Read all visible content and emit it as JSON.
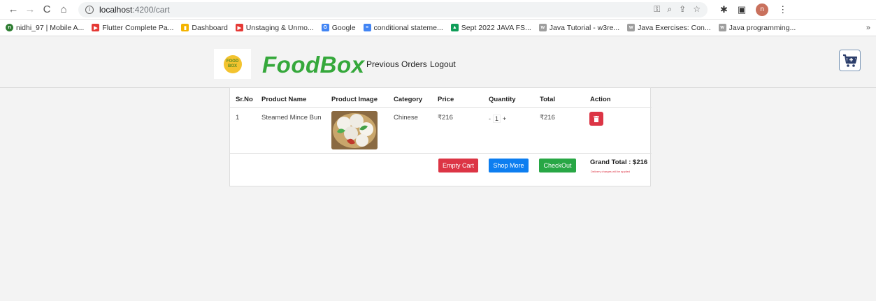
{
  "browser": {
    "url_host": "localhost",
    "url_path": ":4200/cart",
    "avatar_letter": "n",
    "bookmarks": [
      {
        "label": "nidhi_97 | Mobile A...",
        "color": "#2e7d32",
        "glyph": "n"
      },
      {
        "label": "Flutter Complete Pa...",
        "color": "#e53935",
        "glyph": "▶"
      },
      {
        "label": "Dashboard",
        "color": "#f4b400",
        "glyph": "▮"
      },
      {
        "label": "Unstaging & Unmo...",
        "color": "#e53935",
        "glyph": "▶"
      },
      {
        "label": "Google",
        "color": "#4285f4",
        "glyph": "G"
      },
      {
        "label": "conditional stateme...",
        "color": "#4285f4",
        "glyph": "≡"
      },
      {
        "label": "Sept 2022 JAVA FS...",
        "color": "#0f9d58",
        "glyph": "▲"
      },
      {
        "label": "Java Tutorial - w3re...",
        "color": "#9e9e9e",
        "glyph": "w"
      },
      {
        "label": "Java Exercises: Con...",
        "color": "#9e9e9e",
        "glyph": "w"
      },
      {
        "label": "Java programming...",
        "color": "#9e9e9e",
        "glyph": "w"
      }
    ],
    "more": "»"
  },
  "header": {
    "logo_line1": "FOOD",
    "logo_line2": "BOX",
    "brand": "FoodBox",
    "nav_previous_orders": "Previous Orders",
    "nav_logout": "Logout"
  },
  "cart": {
    "columns": {
      "srno": "Sr.No",
      "product_name": "Product Name",
      "product_image": "Product Image",
      "category": "Category",
      "price": "Price",
      "quantity": "Quantity",
      "total": "Total",
      "action": "Action"
    },
    "rows": [
      {
        "srno": "1",
        "product_name": "Steamed Mince Bun",
        "category": "Chinese",
        "price": "₹216",
        "qty_minus": "-",
        "quantity": "1",
        "qty_plus": "+",
        "total": "₹216"
      }
    ],
    "empty_cart_label": "Empty Cart",
    "shop_more_label": "Shop More",
    "checkout_label": "CheckOut",
    "grand_total": "Grand Total : $216",
    "delivery_note": "Delivery charges will be applied"
  },
  "colors": {
    "brand_green": "#35a83b",
    "danger": "#dc3545",
    "primary": "#0d7ef0",
    "success": "#28a745"
  }
}
